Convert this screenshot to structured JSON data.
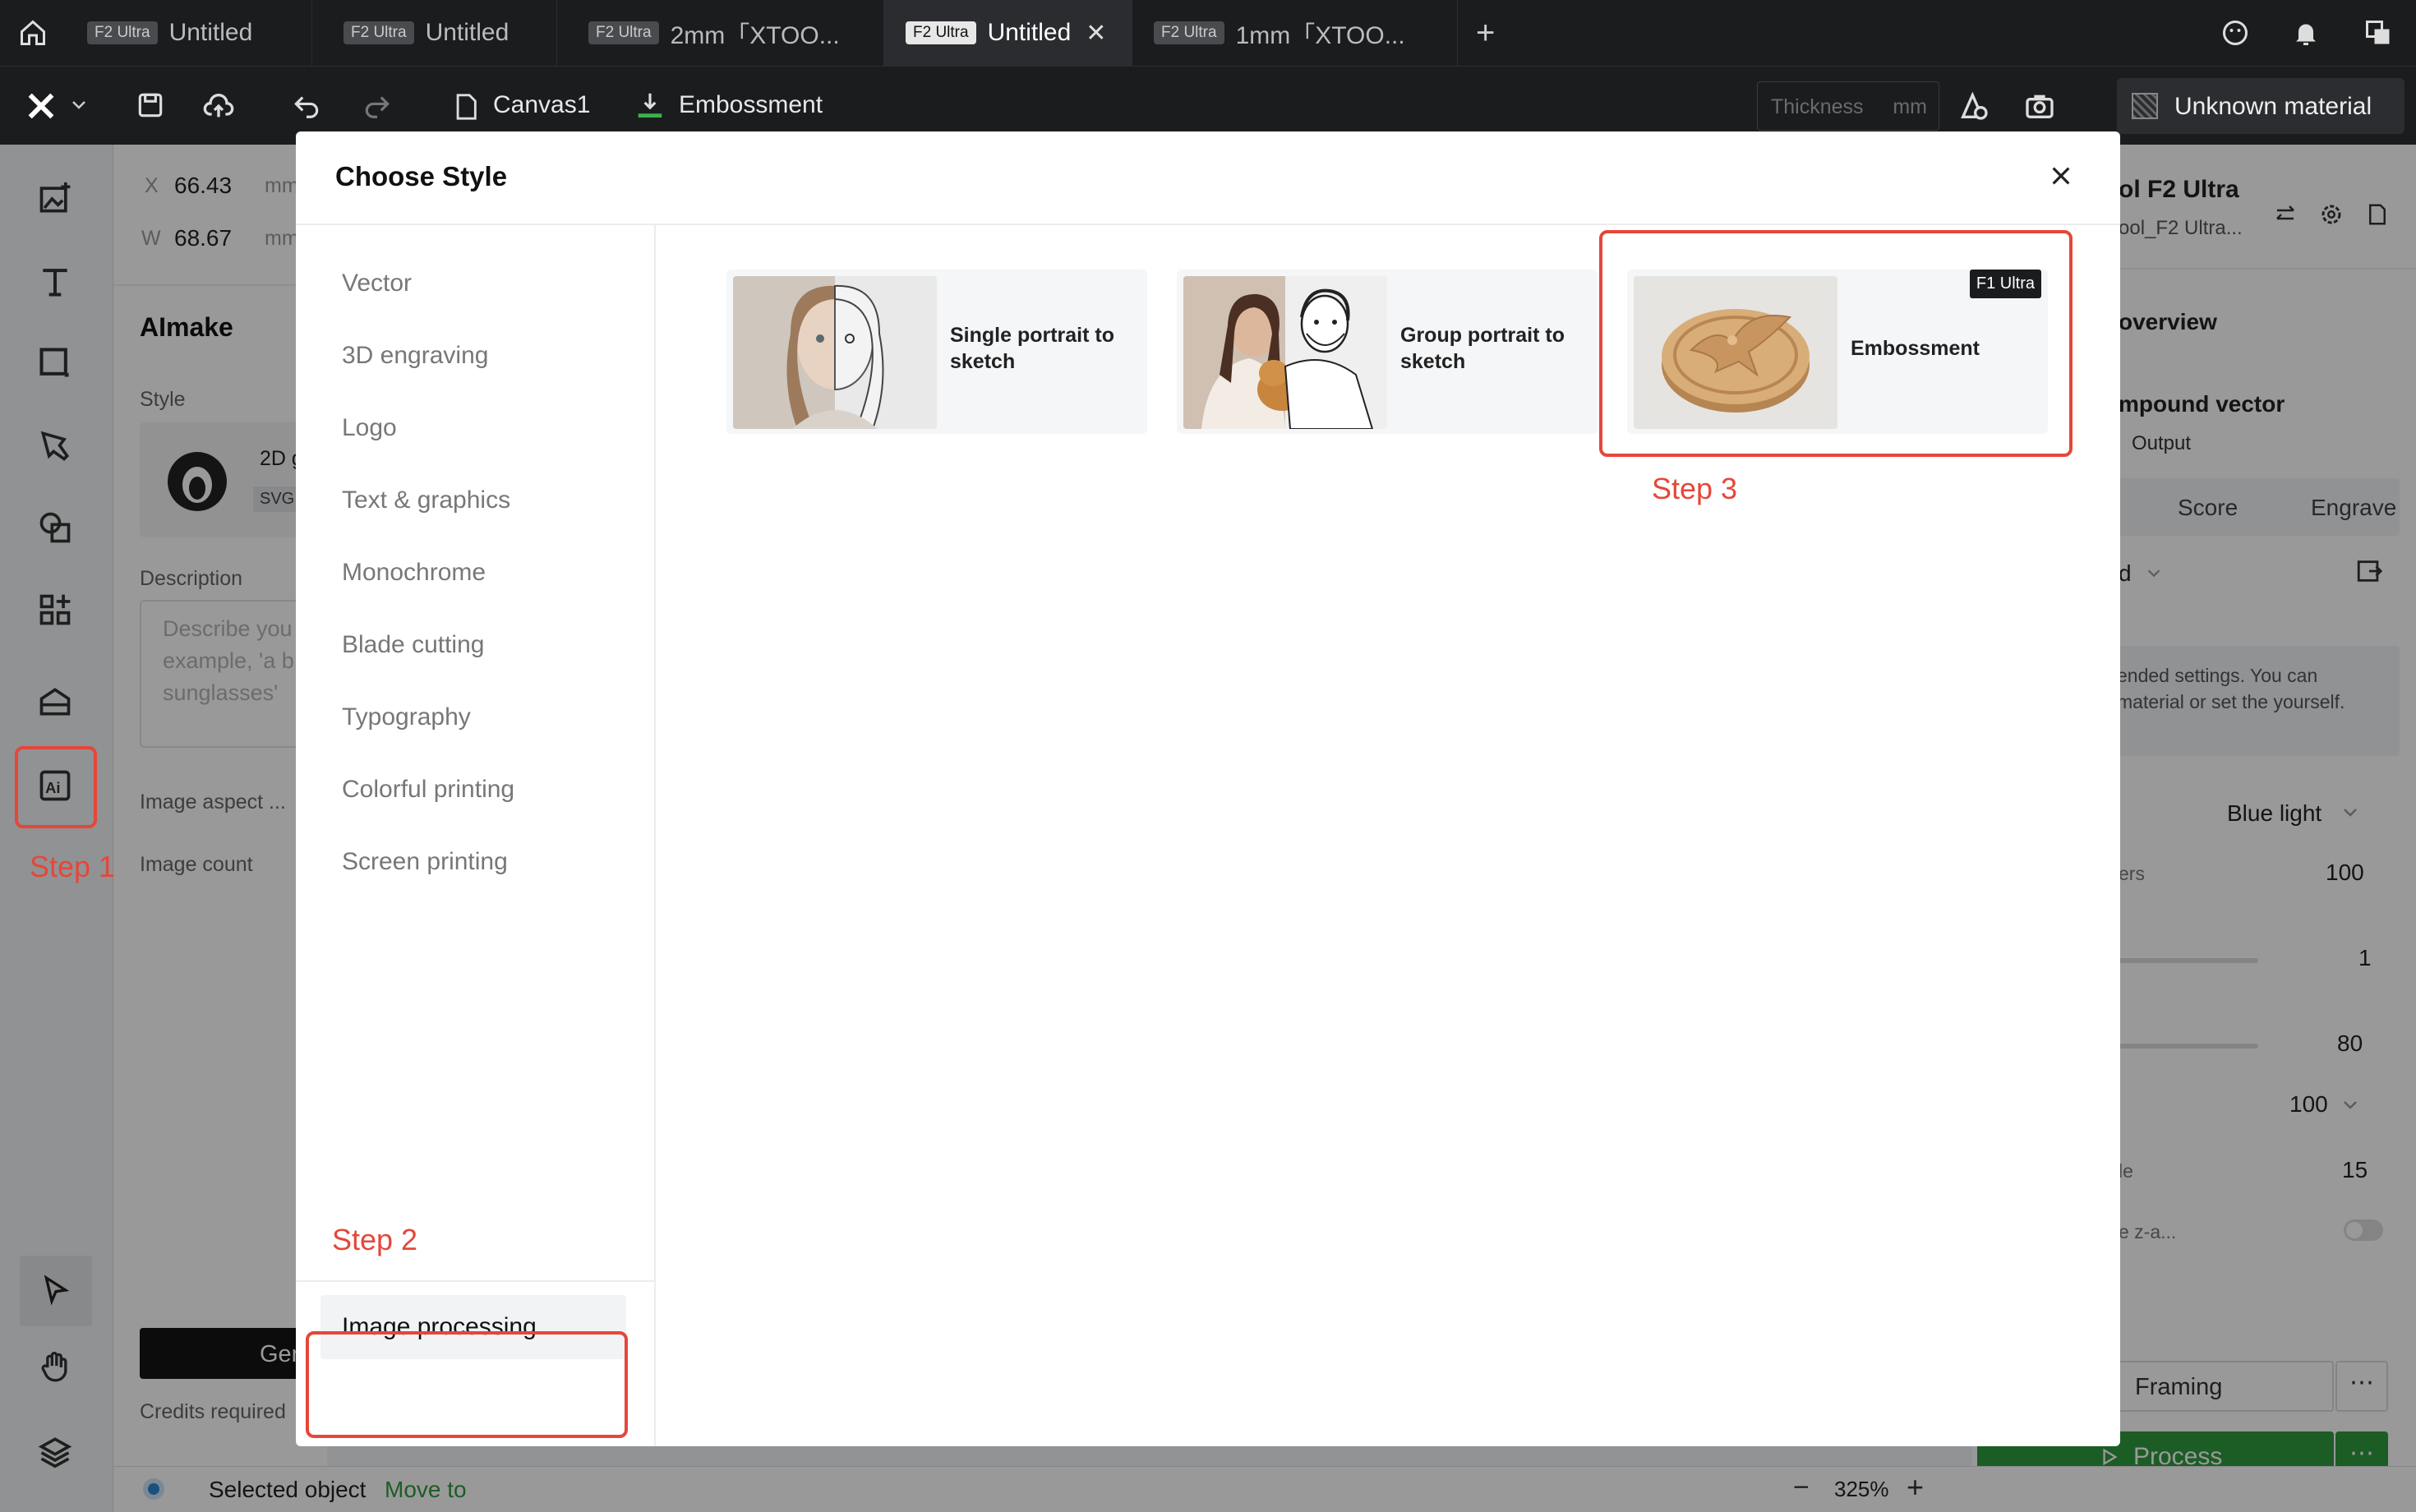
{
  "tabs": [
    {
      "badge": "F2 Ultra",
      "label": "Untitled",
      "active": false
    },
    {
      "badge": "F2 Ultra",
      "label": "Untitled",
      "active": false
    },
    {
      "badge": "F2 Ultra",
      "label": "2mm「XTOO...",
      "active": false
    },
    {
      "badge": "F2 Ultra",
      "label": "Untitled",
      "active": true
    },
    {
      "badge": "F2 Ultra",
      "label": "1mm「XTOO...",
      "active": false
    }
  ],
  "toolbar": {
    "canvas": "Canvas1",
    "mode": "Embossment",
    "thickness_placeholder": "Thickness",
    "thickness_unit": "mm",
    "material": "Unknown material"
  },
  "panel": {
    "x_label": "X",
    "x_value": "66.43",
    "x_unit": "mm",
    "w_label": "W",
    "w_value": "68.67",
    "w_unit": "mm",
    "title": "AImake",
    "style_label": "Style",
    "style_value": "2D g",
    "style_tag": "SVG",
    "description_label": "Description",
    "description_placeholder": "Describe you example, 'a b sunglasses'",
    "aspect_label": "Image aspect ...",
    "count_label": "Image count",
    "generate_label": "Gen",
    "credits_label": "Credits required"
  },
  "right": {
    "device": "ol F2 Ultra",
    "device_sub": "ool_F2 Ultra...",
    "overview": "overview",
    "compound": "mpound vector",
    "output": "Output",
    "score": "Score",
    "engrave": "Engrave",
    "dropdown_a": "d",
    "notice": "ended settings. You can material or set the yourself.",
    "light": "Blue light",
    "row1_label": "ers",
    "row1_value": "100",
    "row2_value": "1",
    "row3_value": "80",
    "row4_value": "100",
    "row5_label": "le",
    "row5_value": "15",
    "row6_label": "e z-a...",
    "framing": "Framing",
    "process": "Process"
  },
  "status": {
    "prefix": "Selected object",
    "action": "Move to",
    "zoom": "325%"
  },
  "modal": {
    "title": "Choose Style",
    "categories": [
      "Vector",
      "3D engraving",
      "Logo",
      "Text & graphics",
      "Monochrome",
      "Blade cutting",
      "Typography",
      "Colorful printing",
      "Screen printing"
    ],
    "selected_category": "Image processing",
    "cards": [
      {
        "label": "Single portrait to sketch",
        "tag": ""
      },
      {
        "label": "Group portrait to sketch",
        "tag": ""
      },
      {
        "label": "Embossment",
        "tag": "F1 Ultra"
      }
    ]
  },
  "steps": {
    "s1": "Step 1",
    "s2": "Step 2",
    "s3": "Step 3"
  },
  "colors": {
    "accent_red": "#e5473a",
    "process_green": "#2f9a3f",
    "link_green": "#2f9a3f"
  }
}
